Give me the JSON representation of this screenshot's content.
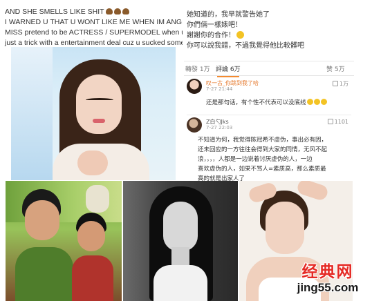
{
  "left_post": {
    "lines": [
      "AND SHE SMELLS LIKE SHIT",
      "I WARNED U THAT U WONT LIKE ME WHEN IM ANGRY",
      "MISS pretend to be ACTRESS / SUPERMODEL when ur",
      "just a trick with a entertainment deal cuz u sucked some"
    ],
    "photo_icon": "portrait-photo"
  },
  "right_post": {
    "quote_lines": [
      "她知道的，我早就警告她了",
      "你們倆一樣婊吧！",
      "謝謝你的合作！",
      "你可以說我錯，不過我覺得他比較髒吧"
    ],
    "tabs": [
      {
        "label": "轉發 1万"
      },
      {
        "label": "評論 6万"
      },
      {
        "label": "赞 5万"
      }
    ],
    "comments": [
      {
        "user": "叹一古_你跳到我了哈",
        "time": "7-27 21:44",
        "likes": "1万",
        "text": "还是那句话，有个性不代表可以没底线"
      },
      {
        "user": "Z白勺Jks",
        "time": "7-27 22:03",
        "likes": "1101",
        "text_lines": [
          "不知道为何，我觉得陈冠希不虚伪，事出必有因，",
          "还未回应的一方往往会得到大家的同情，无风不起",
          "浪，，，，人都是一边说着讨厌虚伪的人，一边",
          "喜欢虚伪的人，如果不骂人=素质高，那么素质最",
          "高的就是出家人了"
        ]
      }
    ]
  },
  "watermark": {
    "cn": "经典网",
    "en": "jing55.com"
  },
  "colors": {
    "accent": "#f48a2f",
    "username": "#e5772a",
    "watermark_red": "#e52a24"
  }
}
